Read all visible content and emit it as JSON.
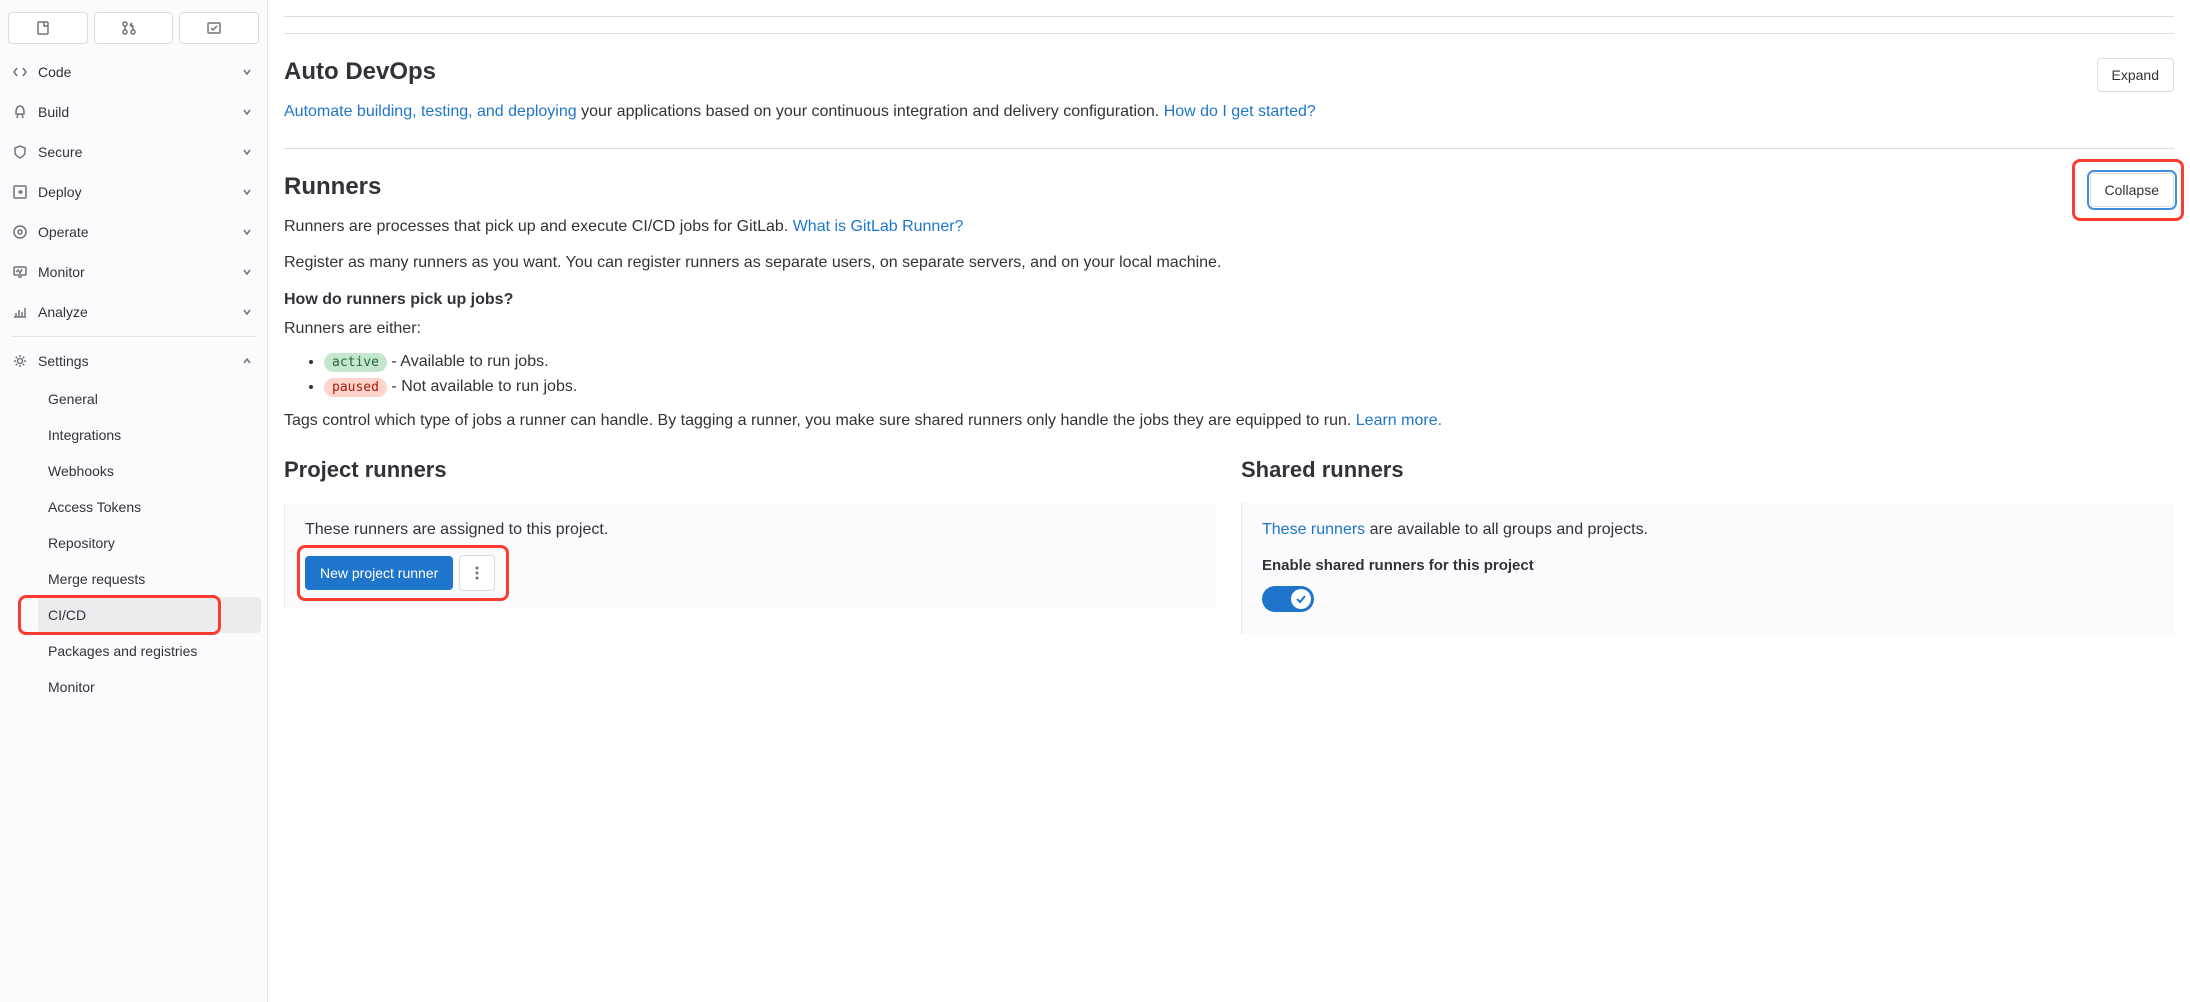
{
  "sidebar": {
    "items": [
      {
        "label": "Code"
      },
      {
        "label": "Build"
      },
      {
        "label": "Secure"
      },
      {
        "label": "Deploy"
      },
      {
        "label": "Operate"
      },
      {
        "label": "Monitor"
      },
      {
        "label": "Analyze"
      },
      {
        "label": "Settings"
      }
    ],
    "settings_sub": [
      {
        "label": "General"
      },
      {
        "label": "Integrations"
      },
      {
        "label": "Webhooks"
      },
      {
        "label": "Access Tokens"
      },
      {
        "label": "Repository"
      },
      {
        "label": "Merge requests"
      },
      {
        "label": "CI/CD"
      },
      {
        "label": "Packages and registries"
      },
      {
        "label": "Monitor"
      }
    ]
  },
  "auto_devops": {
    "title": "Auto DevOps",
    "expand_label": "Expand",
    "link_text": "Automate building, testing, and deploying",
    "desc_suffix": " your applications based on your continuous integration and delivery configuration. ",
    "get_started_link": "How do I get started?"
  },
  "runners": {
    "title": "Runners",
    "collapse_label": "Collapse",
    "desc_prefix": "Runners are processes that pick up and execute CI/CD jobs for GitLab. ",
    "what_is_link": "What is GitLab Runner?",
    "register_desc": "Register as many runners as you want. You can register runners as separate users, on separate servers, and on your local machine.",
    "pickup_heading": "How do runners pick up jobs?",
    "either_text": "Runners are either:",
    "active_badge": "active",
    "active_desc": " - Available to run jobs.",
    "paused_badge": "paused",
    "paused_desc": " - Not available to run jobs.",
    "tags_desc": "Tags control which type of jobs a runner can handle. By tagging a runner, you make sure shared runners only handle the jobs they are equipped to run. ",
    "learn_more_link": "Learn more.",
    "project_runners": {
      "title": "Project runners",
      "assigned_text": "These runners are assigned to this project.",
      "new_button": "New project runner"
    },
    "shared_runners": {
      "title": "Shared runners",
      "these_link": "These runners",
      "desc_suffix": " are available to all groups and projects.",
      "enable_label": "Enable shared runners for this project"
    }
  }
}
